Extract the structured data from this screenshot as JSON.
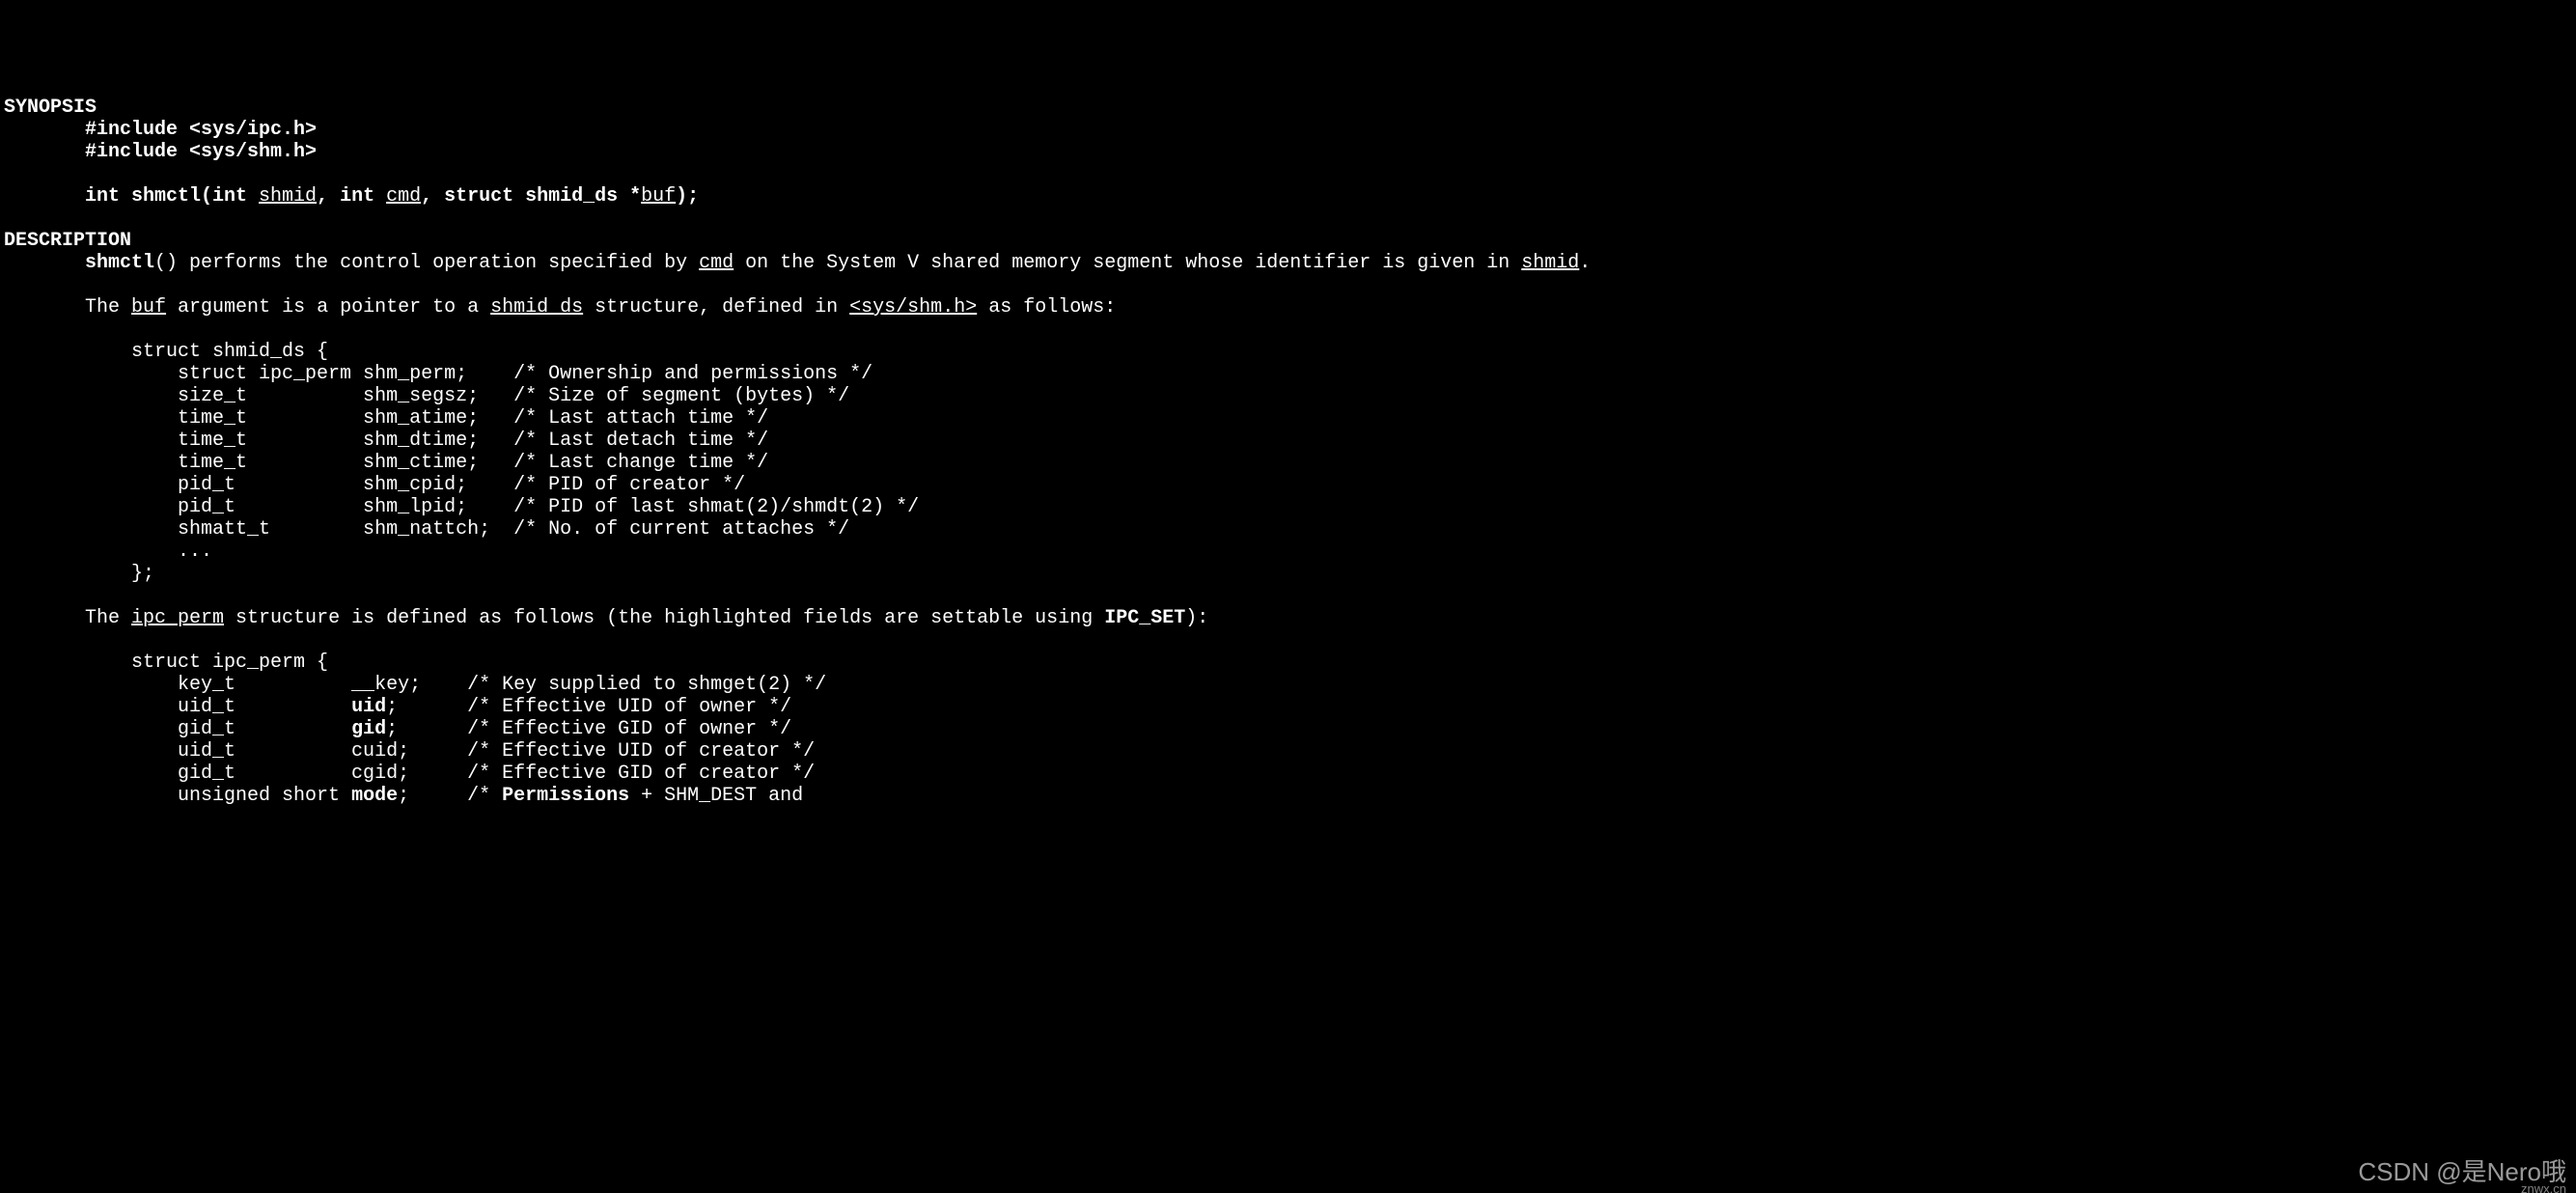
{
  "sections": {
    "synopsis": {
      "heading": "SYNOPSIS",
      "include1_pre": "       ",
      "include1_b": "#include <sys/ipc.h>",
      "include2_pre": "       ",
      "include2_b": "#include <sys/shm.h>",
      "sig_indent": "       ",
      "sig_p1": "int shmctl(int ",
      "sig_shmid": "shmid",
      "sig_p2": ", int ",
      "sig_cmd": "cmd",
      "sig_p3": ", struct shmid_ds *",
      "sig_buf": "buf",
      "sig_p4": ");"
    },
    "description": {
      "heading": "DESCRIPTION",
      "line1_indent": "       ",
      "line1_b1": "shmctl",
      "line1_t1": "() performs the control operation specified by ",
      "line1_u1": "cmd",
      "line1_t2": " on the System V shared memory segment whose identifier is given in ",
      "line1_u2": "shmid",
      "line1_t3": ".",
      "line2_indent": "       ",
      "line2_t1": "The ",
      "line2_u1": "buf",
      "line2_t2": " argument is a pointer to a ",
      "line2_u2": "shmid_ds",
      "line2_t3": " structure, defined in ",
      "line2_u3": "<sys/shm.h>",
      "line2_t4": " as follows:",
      "struct1": {
        "l0": "           struct shmid_ds {",
        "l1": "               struct ipc_perm shm_perm;    /* Ownership and permissions */",
        "l2": "               size_t          shm_segsz;   /* Size of segment (bytes) */",
        "l3": "               time_t          shm_atime;   /* Last attach time */",
        "l4": "               time_t          shm_dtime;   /* Last detach time */",
        "l5": "               time_t          shm_ctime;   /* Last change time */",
        "l6": "               pid_t           shm_cpid;    /* PID of creator */",
        "l7": "               pid_t           shm_lpid;    /* PID of last shmat(2)/shmdt(2) */",
        "l8": "               shmatt_t        shm_nattch;  /* No. of current attaches */",
        "l9": "               ...",
        "l10": "           };"
      },
      "line3_indent": "       ",
      "line3_t1": "The ",
      "line3_u1": "ipc_perm",
      "line3_t2": " structure is defined as follows (the highlighted fields are settable using ",
      "line3_b1": "IPC_SET",
      "line3_t3": "):",
      "struct2": {
        "l0": "           struct ipc_perm {",
        "l1": "               key_t          __key;    /* Key supplied to shmget(2) */",
        "l2a": "               uid_t          ",
        "l2b": "uid",
        "l2c": ";      /* Effective UID of owner */",
        "l3a": "               gid_t          ",
        "l3b": "gid",
        "l3c": ";      /* Effective GID of owner */",
        "l4": "               uid_t          cuid;     /* Effective UID of creator */",
        "l5": "               gid_t          cgid;     /* Effective GID of creator */",
        "l6a": "               unsigned short ",
        "l6b": "mode",
        "l6c": ";     /* ",
        "l6d": "Permissions",
        "l6e": " + SHM_DEST and"
      }
    }
  },
  "watermark": {
    "main": "CSDN @是Nero哦",
    "sub": "znwx.cn"
  }
}
